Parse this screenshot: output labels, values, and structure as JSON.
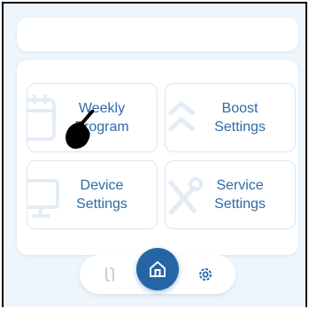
{
  "tiles": [
    {
      "label": "Weekly\nProgram",
      "icon": "calendar-icon"
    },
    {
      "label": "Boost\nSettings",
      "icon": "chevrons-up-icon"
    },
    {
      "label": "Device\nSettings",
      "icon": "monitor-icon"
    },
    {
      "label": "Service\nSettings",
      "icon": "tools-icon"
    }
  ],
  "nav": {
    "left_icon": "swap-icon",
    "home_icon": "home-icon",
    "settings_icon": "gear-icon"
  },
  "colors": {
    "accent": "#2466a5",
    "label": "#2d6aa8",
    "background": "#eef5fb",
    "icon_faint": "#e3ecf5"
  }
}
